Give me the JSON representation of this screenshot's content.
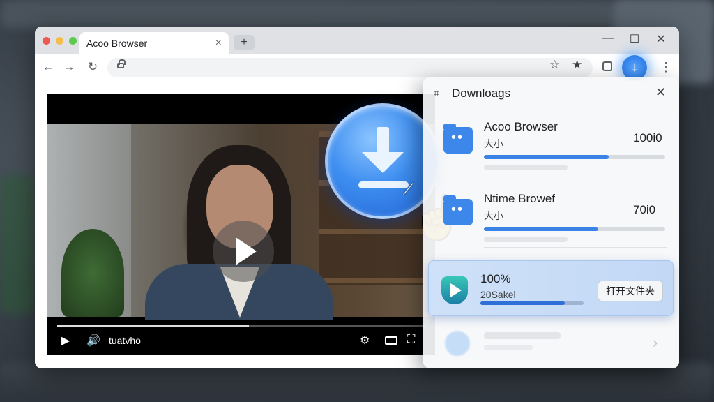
{
  "browser": {
    "tab_title": "Acoo Browser",
    "tab_close": "×",
    "new_tab": "+",
    "window_controls": {
      "minimize": "—",
      "maximize": "☐",
      "close": "✕"
    },
    "nav": {
      "back": "←",
      "forward": "→",
      "reload": "↻"
    },
    "toolbar_icons": {
      "bookmark": "☆",
      "bookmark_filled": "★",
      "menu": "⋮",
      "download": "↓"
    }
  },
  "video": {
    "time_label": "tuatvho",
    "progress_fraction": 0.52,
    "controls": {
      "play": "▶",
      "volume": "🔊",
      "settings": "⚙",
      "fullscreen": "⛶"
    }
  },
  "downloads_panel": {
    "title": "Downloags",
    "header_icon": "⌗",
    "close": "✕",
    "items": [
      {
        "name": "Acoo Browser",
        "sub": "大小",
        "value": "100i0",
        "progress": 0.69
      },
      {
        "name": "Ntime Browef",
        "sub": "大小",
        "value": "70i0",
        "progress": 0.63
      }
    ],
    "active_item": {
      "percent": "100%",
      "name": "20Sakel",
      "progress": 0.82,
      "button_label": "打开文件夹"
    },
    "next_chevron": "›"
  },
  "overlay": {
    "hand_cursor": "☝",
    "click_rays": "⟋"
  },
  "colors": {
    "accent": "#3b82e6",
    "panel_bg": "#f6f7f9",
    "active_bg": "#c8dcf6"
  }
}
